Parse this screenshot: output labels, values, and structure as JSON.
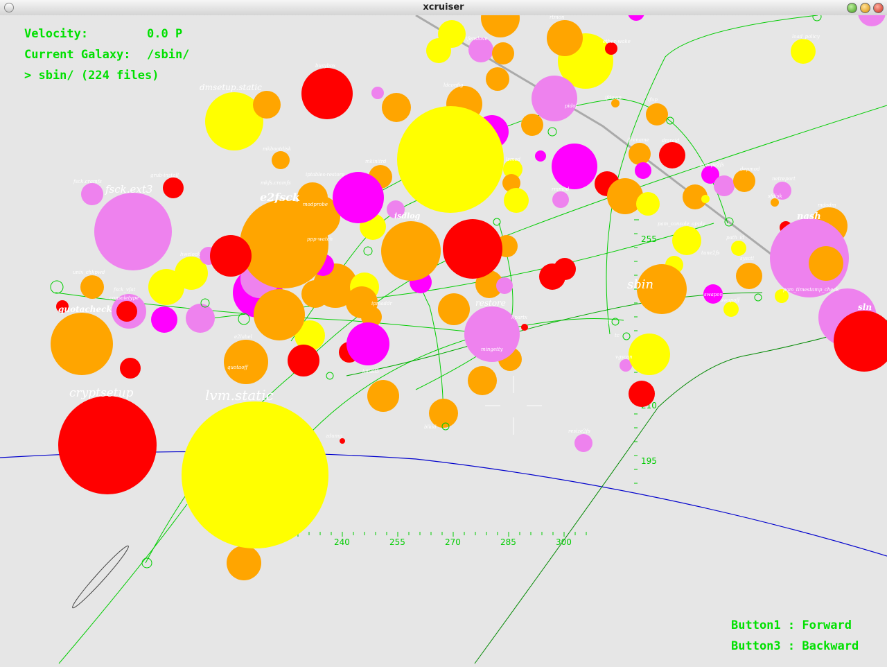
{
  "window": {
    "title": "xcruiser"
  },
  "hud": {
    "velocity_label": "Velocity:",
    "velocity_value": "0.0 P",
    "galaxy_label": "Current Galaxy:",
    "galaxy_value": "/sbin/",
    "listing": "> sbin/ (224 files)",
    "button1": "Button1 : Forward",
    "button3": "Button3 : Backward"
  },
  "scale": {
    "horizontal_ticks": [
      "240",
      "255",
      "270",
      "285",
      "300"
    ],
    "vertical_ticks": [
      "255",
      "240",
      "225",
      "210",
      "195"
    ]
  },
  "colors": {
    "background": "#e6e6e6",
    "hud_text": "#00e000",
    "orbit_green": "#00cc00",
    "orbit_blue": "#0000cc",
    "star_yellow": "#ffff00",
    "star_orange": "#ffa500",
    "star_red": "#ff0000",
    "star_magenta": "#ff00ff",
    "star_violet": "#ee82ee"
  },
  "labels": {
    "big": [
      "cryptsetup",
      "lvm.static",
      "fsck.ext3",
      "e2fsck",
      "sbin",
      "quotacheck",
      "restore",
      "dmsetup.static",
      "nash",
      "isdlog",
      "sln"
    ],
    "small": [
      "fsck.cramfs",
      "grub-install",
      "mkbootdisk",
      "mkfs.cramfs",
      "mkinitrd",
      "modprobe",
      "iptables-restore",
      "netreport",
      "unix_chkpwd",
      "fsck_vfat",
      "consoletype",
      "quotaoff",
      "e2label",
      "resize2fs",
      "sfdisk",
      "ifdown",
      "ifup",
      "ifrename",
      "pam_console_apply",
      "path_id",
      "swapon",
      "swapoff",
      "sysctl",
      "tune2fs",
      "vgscan",
      "zdump",
      "mingetty",
      "kpartx",
      "depmod",
      "dumpe2fs",
      "ldconfig",
      "lsmod",
      "rmmod",
      "hwclock",
      "ipmaddr",
      "killall5",
      "blkid",
      "ether-wake",
      "ifenslave",
      "busybox",
      "pidof",
      "pam_timestamp_check",
      "tc",
      "ip",
      "dmraid",
      "mdadm",
      "load_policy",
      "ppp-watch",
      "rtmon"
    ]
  }
}
